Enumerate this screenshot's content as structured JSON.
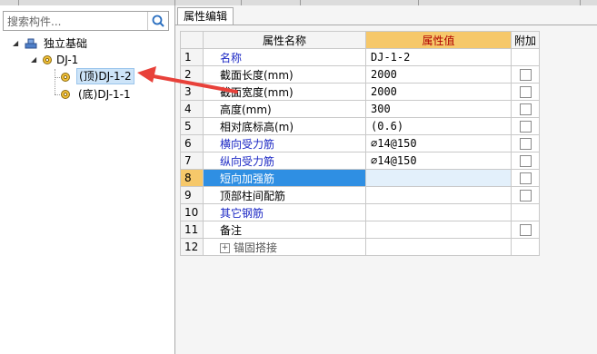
{
  "search": {
    "placeholder": "搜索构件..."
  },
  "tree": {
    "root": {
      "label": "独立基础"
    },
    "group": {
      "label": "DJ-1"
    },
    "children": [
      {
        "label": "(顶)DJ-1-2",
        "selected": true
      },
      {
        "label": "(底)DJ-1-1",
        "selected": false
      }
    ]
  },
  "tab": {
    "label": "属性编辑"
  },
  "grid": {
    "headers": {
      "name": "属性名称",
      "value": "属性值",
      "extra": "附加"
    },
    "rows": [
      {
        "num": "1",
        "name": "名称",
        "value": "DJ-1-2",
        "style": "blue",
        "checkbox": false
      },
      {
        "num": "2",
        "name": "截面长度(mm)",
        "value": "2000",
        "style": "black",
        "checkbox": true
      },
      {
        "num": "3",
        "name": "截面宽度(mm)",
        "value": "2000",
        "style": "black",
        "checkbox": true
      },
      {
        "num": "4",
        "name": "高度(mm)",
        "value": "300",
        "style": "black",
        "checkbox": true
      },
      {
        "num": "5",
        "name": "相对底标高(m)",
        "value": "(0.6)",
        "style": "black",
        "checkbox": true
      },
      {
        "num": "6",
        "name": "横向受力筋",
        "value": "⌀14@150",
        "style": "blue",
        "checkbox": true
      },
      {
        "num": "7",
        "name": "纵向受力筋",
        "value": "⌀14@150",
        "style": "blue",
        "checkbox": true
      },
      {
        "num": "8",
        "name": "短向加强筋",
        "value": "",
        "style": "blue",
        "checkbox": true,
        "selected": true
      },
      {
        "num": "9",
        "name": "顶部柱间配筋",
        "value": "",
        "style": "black",
        "checkbox": true
      },
      {
        "num": "10",
        "name": "其它钢筋",
        "value": "",
        "style": "blue",
        "checkbox": false
      },
      {
        "num": "11",
        "name": "备注",
        "value": "",
        "style": "black",
        "checkbox": true
      },
      {
        "num": "12",
        "name": "锚固搭接",
        "value": "",
        "style": "gray",
        "checkbox": false,
        "expandable": true
      }
    ]
  },
  "colors": {
    "selection": "#2f8fe3",
    "header_value": "#f6c86a",
    "annotation_arrow": "#e8413a",
    "label_blue": "#1b27c4"
  }
}
